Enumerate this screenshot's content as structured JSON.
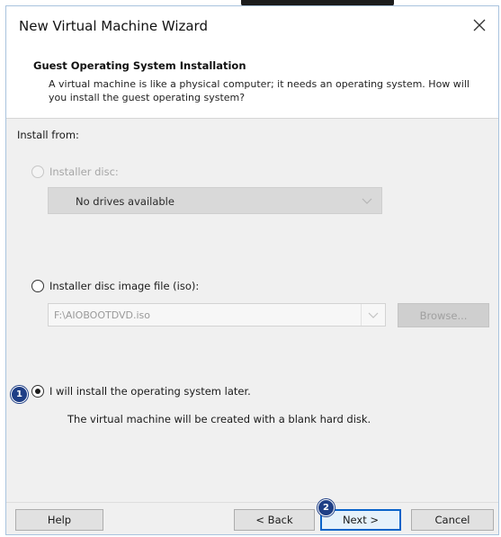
{
  "window": {
    "title": "New Virtual Machine Wizard"
  },
  "header": {
    "title": "Guest Operating System Installation",
    "description": "A virtual machine is like a physical computer; it needs an operating system. How will you install the guest operating system?"
  },
  "install_from": {
    "label": "Install from:",
    "installer_disc": {
      "label": "Installer disc:",
      "enabled": false,
      "dropdown_value": "No drives available"
    },
    "iso_file": {
      "label": "Installer disc image file (iso):",
      "value": "F:\\AIOBOOTDVD.iso",
      "browse_label": "Browse..."
    },
    "install_later": {
      "label": "I will install the operating system later.",
      "selected": true,
      "description": "The virtual machine will be created with a blank hard disk."
    }
  },
  "footer": {
    "help_label": "Help",
    "back_label": "< Back",
    "next_label": "Next >",
    "cancel_label": "Cancel"
  },
  "annotations": {
    "step1": "1",
    "step2": "2"
  },
  "colors": {
    "accent": "#0a63c9",
    "badge": "#1f3f86",
    "content_bg": "#f0f0f0"
  }
}
